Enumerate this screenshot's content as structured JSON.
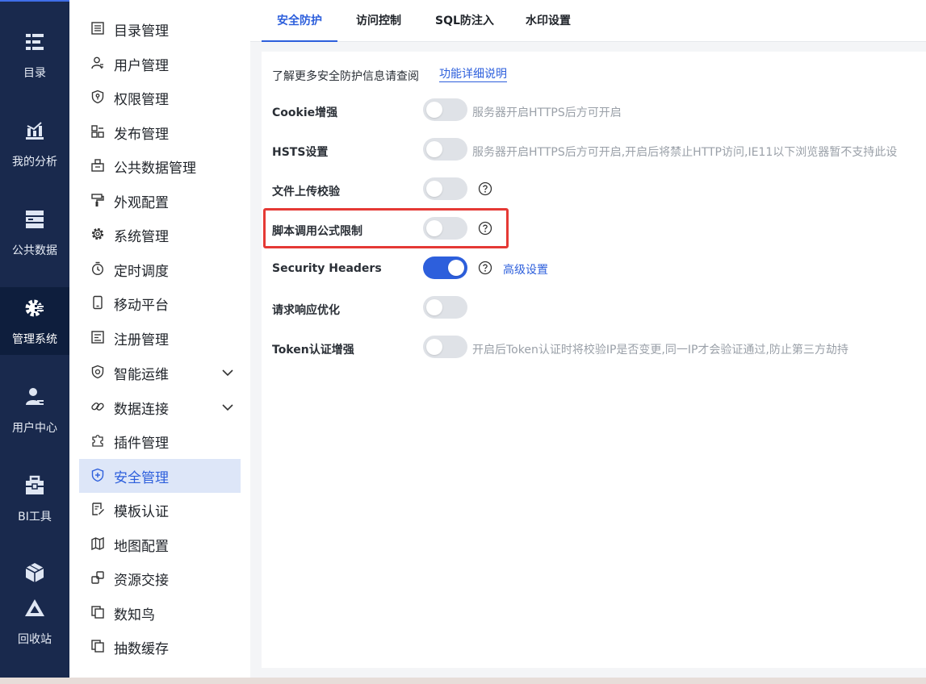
{
  "rail": {
    "items": [
      {
        "label": "目录",
        "icon": "catalog-icon"
      },
      {
        "label": "我的分析",
        "icon": "analysis-chart-icon"
      },
      {
        "label": "公共数据",
        "icon": "public-data-icon"
      },
      {
        "label": "管理系统",
        "icon": "manage-gear-icon",
        "active": true
      },
      {
        "label": "用户中心",
        "icon": "user-center-icon"
      },
      {
        "label": "BI工具",
        "icon": "toolbox-icon"
      },
      {
        "label": "回收站",
        "icon": "recycle-bin-icon"
      }
    ]
  },
  "subnav": {
    "items": [
      {
        "label": "目录管理",
        "icon": "catalog-list-icon"
      },
      {
        "label": "用户管理",
        "icon": "user-icon"
      },
      {
        "label": "权限管理",
        "icon": "permission-shield-icon"
      },
      {
        "label": "发布管理",
        "icon": "publish-icon"
      },
      {
        "label": "公共数据管理",
        "icon": "public-data-manage-icon"
      },
      {
        "label": "外观配置",
        "icon": "paint-roller-icon"
      },
      {
        "label": "系统管理",
        "icon": "gear-icon"
      },
      {
        "label": "定时调度",
        "icon": "timer-icon"
      },
      {
        "label": "移动平台",
        "icon": "mobile-icon"
      },
      {
        "label": "注册管理",
        "icon": "register-icon"
      },
      {
        "label": "智能运维",
        "icon": "smart-ops-icon",
        "expandable": true
      },
      {
        "label": "数据连接",
        "icon": "link-icon",
        "expandable": true
      },
      {
        "label": "插件管理",
        "icon": "plugin-icon"
      },
      {
        "label": "安全管理",
        "icon": "security-shield-icon",
        "active": true
      },
      {
        "label": "模板认证",
        "icon": "template-cert-icon"
      },
      {
        "label": "地图配置",
        "icon": "map-icon"
      },
      {
        "label": "资源交接",
        "icon": "resource-handover-icon"
      },
      {
        "label": "数知鸟",
        "icon": "copy-doc-icon"
      },
      {
        "label": "抽数缓存",
        "icon": "copy-doc-icon"
      }
    ]
  },
  "tabs": [
    {
      "label": "安全防护",
      "active": true
    },
    {
      "label": "访问控制"
    },
    {
      "label": "SQL防注入"
    },
    {
      "label": "水印设置"
    }
  ],
  "panel": {
    "intro_text": "了解更多安全防护信息请查阅",
    "intro_link": "功能详细说明",
    "settings": [
      {
        "label": "Cookie增强",
        "on": false,
        "hint": "服务器开启HTTPS后方可开启"
      },
      {
        "label": "HSTS设置",
        "on": false,
        "hint": "服务器开启HTTPS后方可开启,开启后将禁止HTTP访问,IE11以下浏览器暂不支持此设"
      },
      {
        "label": "文件上传校验",
        "on": false,
        "help": true
      },
      {
        "label": "脚本调用公式限制",
        "on": false,
        "help": true,
        "highlighted": true
      },
      {
        "label": "Security Headers",
        "on": true,
        "help": true,
        "link": "高级设置"
      },
      {
        "label": "请求响应优化",
        "on": false
      },
      {
        "label": "Token认证增强",
        "on": false,
        "hint": "开启后Token认证时将校验IP是否变更,同一IP才会验证通过,防止第三方劫持"
      }
    ]
  },
  "colors": {
    "rail_bg": "#19294d",
    "accent": "#2d5fdc",
    "highlight_border": "#e53935",
    "toggle_off": "#dfe2e7"
  }
}
